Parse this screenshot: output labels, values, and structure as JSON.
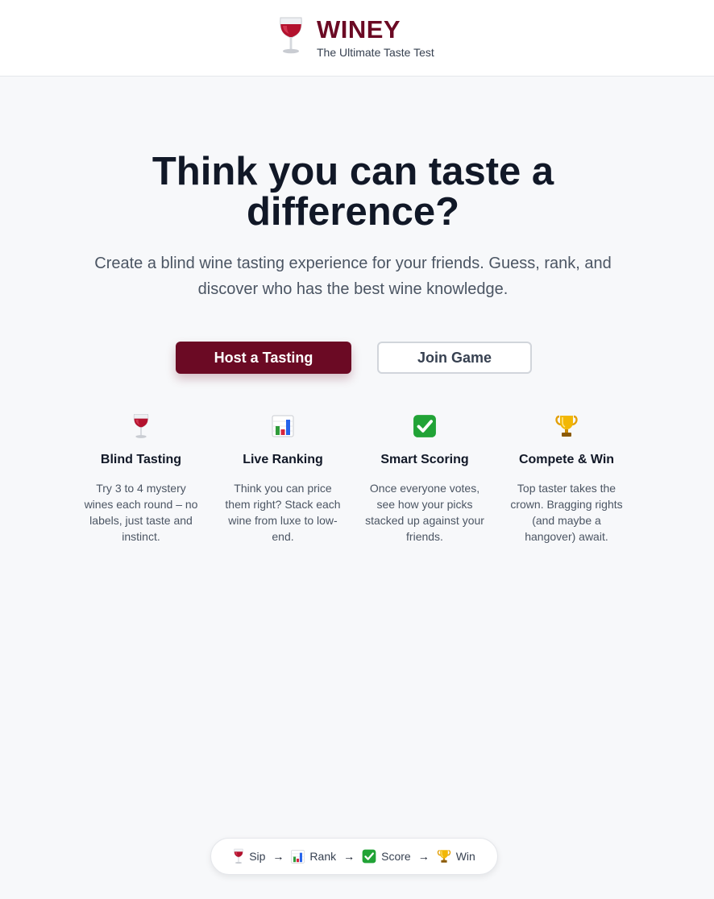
{
  "header": {
    "title": "WINEY",
    "subtitle": "The Ultimate Taste Test",
    "icon": "wine-glass-icon"
  },
  "hero": {
    "title": "Think you can taste a difference?",
    "subtitle": "Create a blind wine tasting experience for your friends. Guess, rank, and discover who has the best wine knowledge."
  },
  "buttons": {
    "host": "Host a Tasting",
    "join": "Join Game"
  },
  "features": [
    {
      "icon": "wine-glass-icon",
      "title": "Blind Tasting",
      "desc": "Try 3 to 4 mystery wines each round – no labels, just taste and instinct."
    },
    {
      "icon": "bar-chart-icon",
      "title": "Live Ranking",
      "desc": "Think you can price them right? Stack each wine from luxe to low-end."
    },
    {
      "icon": "check-mark-icon",
      "title": "Smart Scoring",
      "desc": "Once everyone votes, see how your picks stacked up against your friends."
    },
    {
      "icon": "trophy-icon",
      "title": "Compete & Win",
      "desc": "Top taster takes the crown. Bragging rights (and maybe a hangover) await."
    }
  ],
  "footer": {
    "steps": [
      "Sip",
      "Rank",
      "Score",
      "Win"
    ],
    "arrow": "→"
  },
  "colors": {
    "brand": "#6b0a24",
    "background": "#f7f8fa",
    "check_green": "#16a34a"
  }
}
